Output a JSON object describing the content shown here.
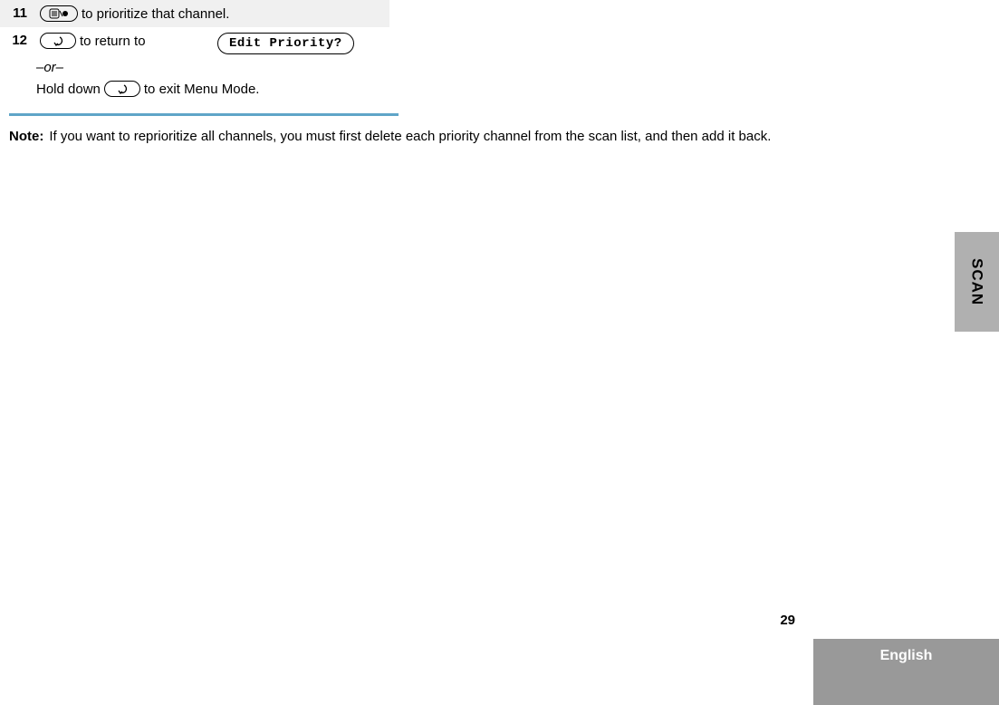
{
  "steps": {
    "s11": {
      "num": "11",
      "text_before": "",
      "button_glyph": "menu-dot",
      "text_after": " to prioritize that channel."
    },
    "s12": {
      "num": "12",
      "line1_text": " to return to",
      "display": "Edit Priority?",
      "or": "–or–",
      "line2_before": "Hold down ",
      "line2_after": " to exit Menu Mode."
    }
  },
  "note": {
    "label": "Note:",
    "text": "If you want to reprioritize all channels, you must first delete each priority channel from the scan list, and then add it back."
  },
  "sidebar": {
    "tab": "SCAN"
  },
  "footer": {
    "page": "29",
    "language": "English"
  }
}
